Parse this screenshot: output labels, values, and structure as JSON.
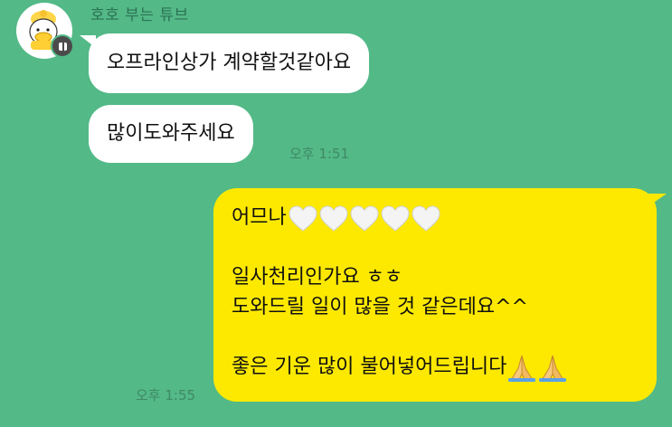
{
  "chat": {
    "sender_name": "호호 부는 튜브",
    "incoming": [
      {
        "text": "오프라인상가 계약할것같아요"
      },
      {
        "text": "많이도와주세요"
      }
    ],
    "incoming_time": "오후 1:51",
    "outgoing": {
      "line1": "어므나",
      "heart_icons": [
        "white-heart-icon",
        "white-heart-icon",
        "white-heart-icon",
        "white-heart-icon",
        "white-heart-icon"
      ],
      "line2": "일사천리인가요 ㅎㅎ",
      "line3": "도와드릴 일이 많을 것 같은데요^^",
      "line4": "좋은 기운 많이 불어넣어드립니다",
      "pray_icons": [
        "folded-hands-icon",
        "folded-hands-icon"
      ]
    },
    "outgoing_time": "오후 1:55"
  },
  "colors": {
    "background": "#53b987",
    "incoming_bubble": "#ffffff",
    "outgoing_bubble": "#fde900"
  }
}
